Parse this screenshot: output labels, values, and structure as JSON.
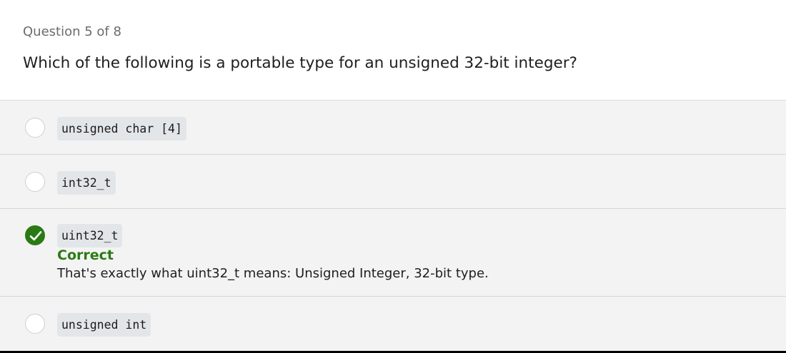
{
  "quiz": {
    "counter": "Question 5 of 8",
    "question": "Which of the following is a portable type for an unsigned 32-bit integer?"
  },
  "options": [
    {
      "label": "unsigned char [4]",
      "state": "unselected"
    },
    {
      "label": "int32_t",
      "state": "unselected"
    },
    {
      "label": "uint32_t",
      "state": "correct"
    },
    {
      "label": "unsigned int",
      "state": "unselected"
    }
  ],
  "feedback": {
    "title": "Correct",
    "text": "That's exactly what uint32_t means: Unsigned Integer, 32-bit type."
  },
  "colors": {
    "correct": "#2a7a14",
    "code_background": "#e3e6e9",
    "options_background": "#f3f3f3"
  },
  "icons": {
    "selected_option": "checkmark-icon"
  }
}
